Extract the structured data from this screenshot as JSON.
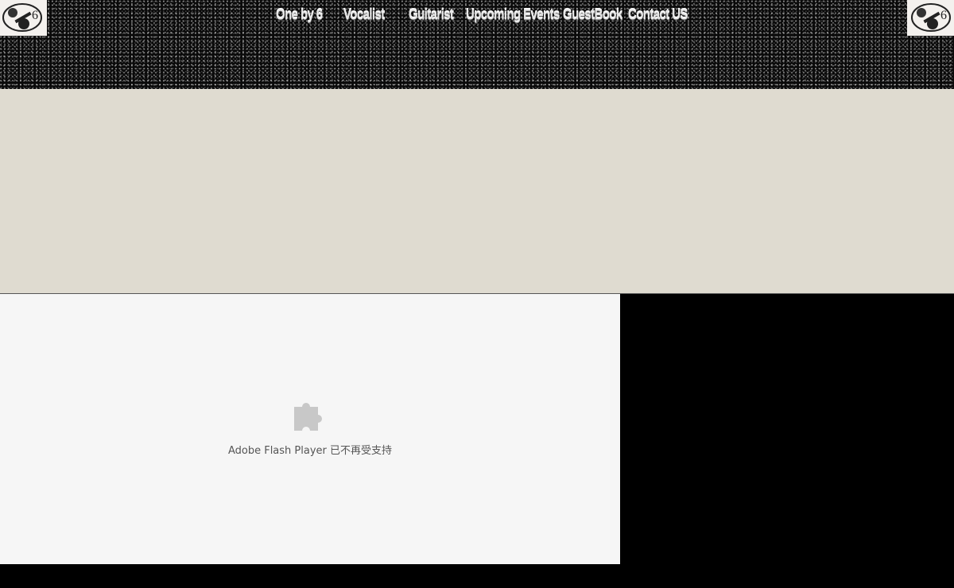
{
  "nav": {
    "items": [
      {
        "label": "One by 6"
      },
      {
        "label": "Vocalist"
      },
      {
        "label": "Guitarist"
      },
      {
        "label": "Upcoming Events"
      },
      {
        "label": "GuestBook"
      },
      {
        "label": "Contact US"
      }
    ]
  },
  "flash": {
    "message": "Adobe Flash Player 已不再受支持",
    "icon": "puzzle-piece-icon"
  },
  "logos": {
    "left": "guitar-logo-icon",
    "right": "guitar-logo-icon"
  },
  "colors": {
    "banner": "#dfdbd0",
    "flash_bg": "#f6f6f6",
    "header_bg": "#0a0a0a"
  }
}
